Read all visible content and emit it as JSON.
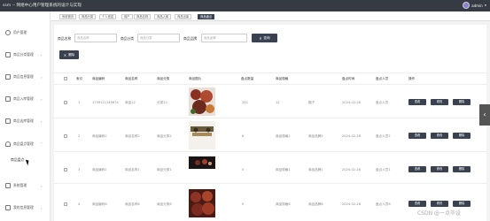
{
  "header": {
    "title": "ssm -- 网络中心用户管理系统的设计与实现",
    "username": "admin"
  },
  "sidebar": {
    "items": [
      {
        "label": "用户管理"
      },
      {
        "label": "商品分类管理"
      },
      {
        "label": "商品信息管理"
      },
      {
        "label": "商品入库管理"
      },
      {
        "label": "商品出库管理"
      },
      {
        "label": "商品盘点管理"
      },
      {
        "label": "系统管理"
      },
      {
        "label": "我的信息管理"
      }
    ],
    "sub_item": "商品盘点"
  },
  "tabs": [
    "系统首页",
    "商品分类",
    "个人信息",
    "用户",
    "商品名称",
    "商品入库",
    "商品出库",
    "商品盘点"
  ],
  "search": {
    "name_label": "商品名称",
    "name_placeholder": "商品名称",
    "category_label": "商品分类",
    "category_placeholder": "商品分类",
    "brand_label": "商品品牌",
    "brand_placeholder": "商品品牌",
    "button": "查询"
  },
  "delete_button": "删除",
  "table": {
    "headers": [
      "索引",
      "商品编码",
      "商品名称",
      "商品分类",
      "商品图片",
      "盘点数量",
      "商品规格",
      "盘点时间",
      "盘点人员",
      "操作"
    ],
    "rows": [
      {
        "index": "1",
        "code": "1709121245674",
        "name": "商品12",
        "category": "分类12",
        "qty": "20C",
        "spec": "12",
        "unit": "箱子",
        "date": "2024-02-28",
        "person": "盘点人员"
      },
      {
        "index": "2",
        "code": "商品编码2",
        "name": "商品名称2",
        "category": "商品分类2",
        "qty": "6",
        "spec": "商品规格2",
        "unit": "商品品牌2",
        "date": "2024-02-28",
        "person": "盘点人员2"
      },
      {
        "index": "3",
        "code": "商品编码1",
        "name": "商品名称1",
        "category": "商品分类1",
        "qty": "5",
        "spec": "商品规格1",
        "unit": "商品品牌1",
        "date": "2024-02-28",
        "person": "盘点人员1"
      },
      {
        "index": "4",
        "code": "商品编码6",
        "name": "商品名称6",
        "category": "商品分类6",
        "qty": "9",
        "spec": "商品规格6",
        "unit": "商品品牌6",
        "date": "2024-02-28",
        "person": "盘点人员6"
      }
    ],
    "actions": [
      "查看",
      "修改",
      "删除"
    ]
  },
  "watermark": "CSDN @一点毕设"
}
